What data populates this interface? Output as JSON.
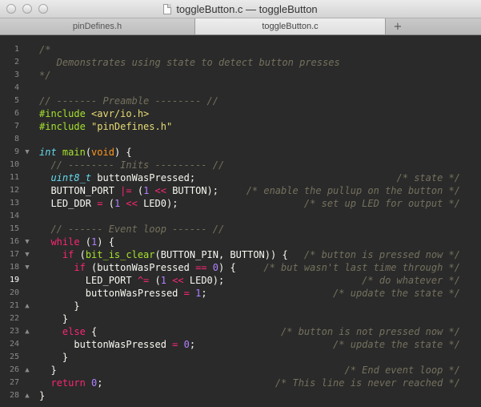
{
  "window": {
    "title": "toggleButton.c — toggleButton"
  },
  "tabs": [
    {
      "label": "pinDefines.h",
      "active": false
    },
    {
      "label": "toggleButton.c",
      "active": true
    }
  ],
  "new_tab_icon": "+",
  "editor": {
    "current_line": 19,
    "lines": [
      {
        "n": 1,
        "fold": "",
        "seg": [
          [
            "c",
            "/*"
          ]
        ],
        "right": ""
      },
      {
        "n": 2,
        "fold": "",
        "seg": [
          [
            "c",
            "   Demonstrates using state to detect button presses"
          ]
        ],
        "right": ""
      },
      {
        "n": 3,
        "fold": "",
        "seg": [
          [
            "c",
            "*/"
          ]
        ],
        "right": ""
      },
      {
        "n": 4,
        "fold": "",
        "seg": [],
        "right": ""
      },
      {
        "n": 5,
        "fold": "",
        "seg": [
          [
            "c",
            "// ------- Preamble -------- //"
          ]
        ],
        "right": ""
      },
      {
        "n": 6,
        "fold": "",
        "seg": [
          [
            "pp",
            "#include "
          ],
          [
            "s",
            "<avr/io.h>"
          ]
        ],
        "right": ""
      },
      {
        "n": 7,
        "fold": "",
        "seg": [
          [
            "pp",
            "#include "
          ],
          [
            "s",
            "\"pinDefines.h\""
          ]
        ],
        "right": ""
      },
      {
        "n": 8,
        "fold": "",
        "seg": [],
        "right": ""
      },
      {
        "n": 9,
        "fold": "down",
        "seg": [
          [
            "t",
            "int "
          ],
          [
            "pp",
            "main"
          ],
          [
            "w",
            "("
          ],
          [
            "f",
            "void"
          ],
          [
            "w",
            ") {"
          ]
        ],
        "right": ""
      },
      {
        "n": 10,
        "fold": "",
        "seg": [
          [
            "c",
            "  // -------- Inits --------- //"
          ]
        ],
        "right": ""
      },
      {
        "n": 11,
        "fold": "",
        "seg": [
          [
            "t",
            "  uint8_t "
          ],
          [
            "w",
            "buttonWasPressed;"
          ]
        ],
        "right": "/* state */"
      },
      {
        "n": 12,
        "fold": "",
        "seg": [
          [
            "w",
            "  BUTTON_PORT "
          ],
          [
            "k",
            "|="
          ],
          [
            "w",
            " ("
          ],
          [
            "n",
            "1"
          ],
          [
            "w",
            " "
          ],
          [
            "k",
            "<<"
          ],
          [
            "w",
            " BUTTON);"
          ]
        ],
        "right": "/* enable the pullup on the button */"
      },
      {
        "n": 13,
        "fold": "",
        "seg": [
          [
            "w",
            "  LED_DDR "
          ],
          [
            "k",
            "="
          ],
          [
            "w",
            " ("
          ],
          [
            "n",
            "1"
          ],
          [
            "w",
            " "
          ],
          [
            "k",
            "<<"
          ],
          [
            "w",
            " LED0);"
          ]
        ],
        "right": "/* set up LED for output */"
      },
      {
        "n": 14,
        "fold": "",
        "seg": [],
        "right": ""
      },
      {
        "n": 15,
        "fold": "",
        "seg": [
          [
            "c",
            "  // ------ Event loop ------ //"
          ]
        ],
        "right": ""
      },
      {
        "n": 16,
        "fold": "down",
        "seg": [
          [
            "k",
            "  while "
          ],
          [
            "w",
            "("
          ],
          [
            "n",
            "1"
          ],
          [
            "w",
            ") {"
          ]
        ],
        "right": ""
      },
      {
        "n": 17,
        "fold": "down",
        "seg": [
          [
            "k",
            "    if "
          ],
          [
            "w",
            "("
          ],
          [
            "pp",
            "bit_is_clear"
          ],
          [
            "w",
            "(BUTTON_PIN, BUTTON)) {"
          ]
        ],
        "right": "/* button is pressed now */"
      },
      {
        "n": 18,
        "fold": "down",
        "seg": [
          [
            "k",
            "      if "
          ],
          [
            "w",
            "(buttonWasPressed "
          ],
          [
            "k",
            "=="
          ],
          [
            "w",
            " "
          ],
          [
            "n",
            "0"
          ],
          [
            "w",
            ") {"
          ]
        ],
        "right": "/* but wasn't last time through */"
      },
      {
        "n": 19,
        "fold": "",
        "seg": [
          [
            "w",
            "        LED_PORT "
          ],
          [
            "k",
            "^="
          ],
          [
            "w",
            " ("
          ],
          [
            "n",
            "1"
          ],
          [
            "w",
            " "
          ],
          [
            "k",
            "<<"
          ],
          [
            "w",
            " LED0);"
          ]
        ],
        "right": "/* do whatever */"
      },
      {
        "n": 20,
        "fold": "",
        "seg": [
          [
            "w",
            "        buttonWasPressed "
          ],
          [
            "k",
            "="
          ],
          [
            "w",
            " "
          ],
          [
            "n",
            "1"
          ],
          [
            "w",
            ";"
          ]
        ],
        "right": "/* update the state */"
      },
      {
        "n": 21,
        "fold": "up",
        "seg": [
          [
            "w",
            "      }"
          ]
        ],
        "right": ""
      },
      {
        "n": 22,
        "fold": "",
        "seg": [
          [
            "w",
            "    }"
          ]
        ],
        "right": ""
      },
      {
        "n": 23,
        "fold": "up",
        "seg": [
          [
            "k",
            "    else "
          ],
          [
            "w",
            "{"
          ]
        ],
        "right": "/* button is not pressed now */"
      },
      {
        "n": 24,
        "fold": "",
        "seg": [
          [
            "w",
            "      buttonWasPressed "
          ],
          [
            "k",
            "="
          ],
          [
            "w",
            " "
          ],
          [
            "n",
            "0"
          ],
          [
            "w",
            ";"
          ]
        ],
        "right": "/* update the state */"
      },
      {
        "n": 25,
        "fold": "",
        "seg": [
          [
            "w",
            "    }"
          ]
        ],
        "right": ""
      },
      {
        "n": 26,
        "fold": "up",
        "seg": [
          [
            "w",
            "  }"
          ]
        ],
        "right": "/* End event loop */"
      },
      {
        "n": 27,
        "fold": "",
        "seg": [
          [
            "k",
            "  return "
          ],
          [
            "n",
            "0"
          ],
          [
            "w",
            ";"
          ]
        ],
        "right": "/* This line is never reached */"
      },
      {
        "n": 28,
        "fold": "up",
        "seg": [
          [
            "w",
            "}"
          ]
        ],
        "right": ""
      }
    ]
  }
}
